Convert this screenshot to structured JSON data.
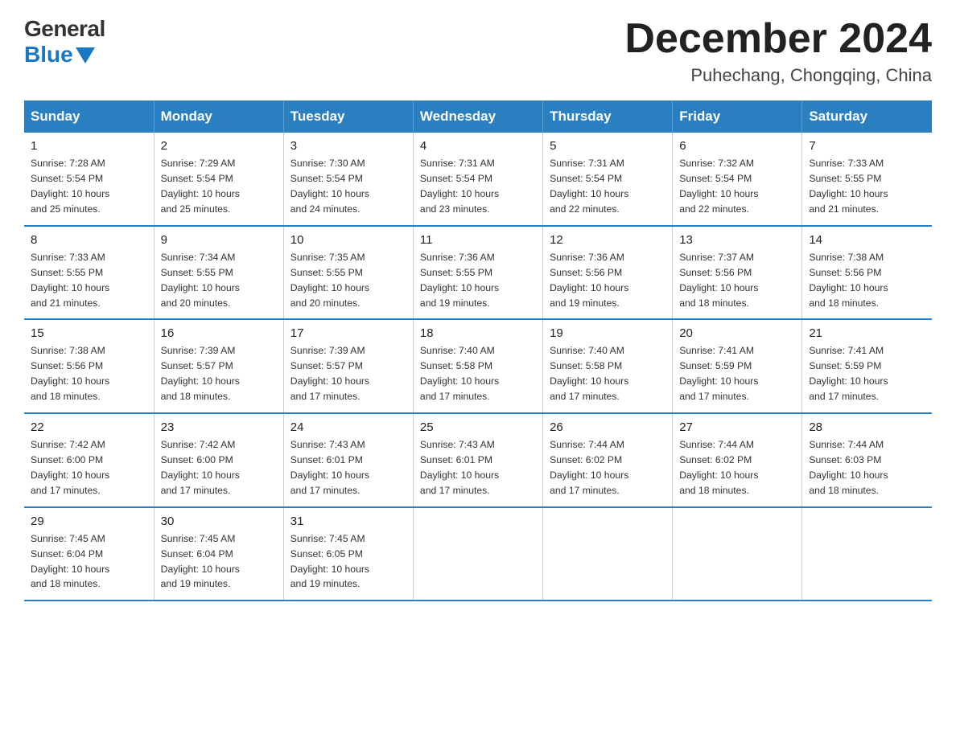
{
  "header": {
    "logo_general": "General",
    "logo_blue": "Blue",
    "title": "December 2024",
    "subtitle": "Puhechang, Chongqing, China"
  },
  "weekdays": [
    "Sunday",
    "Monday",
    "Tuesday",
    "Wednesday",
    "Thursday",
    "Friday",
    "Saturday"
  ],
  "weeks": [
    [
      {
        "day": "1",
        "info": "Sunrise: 7:28 AM\nSunset: 5:54 PM\nDaylight: 10 hours\nand 25 minutes."
      },
      {
        "day": "2",
        "info": "Sunrise: 7:29 AM\nSunset: 5:54 PM\nDaylight: 10 hours\nand 25 minutes."
      },
      {
        "day": "3",
        "info": "Sunrise: 7:30 AM\nSunset: 5:54 PM\nDaylight: 10 hours\nand 24 minutes."
      },
      {
        "day": "4",
        "info": "Sunrise: 7:31 AM\nSunset: 5:54 PM\nDaylight: 10 hours\nand 23 minutes."
      },
      {
        "day": "5",
        "info": "Sunrise: 7:31 AM\nSunset: 5:54 PM\nDaylight: 10 hours\nand 22 minutes."
      },
      {
        "day": "6",
        "info": "Sunrise: 7:32 AM\nSunset: 5:54 PM\nDaylight: 10 hours\nand 22 minutes."
      },
      {
        "day": "7",
        "info": "Sunrise: 7:33 AM\nSunset: 5:55 PM\nDaylight: 10 hours\nand 21 minutes."
      }
    ],
    [
      {
        "day": "8",
        "info": "Sunrise: 7:33 AM\nSunset: 5:55 PM\nDaylight: 10 hours\nand 21 minutes."
      },
      {
        "day": "9",
        "info": "Sunrise: 7:34 AM\nSunset: 5:55 PM\nDaylight: 10 hours\nand 20 minutes."
      },
      {
        "day": "10",
        "info": "Sunrise: 7:35 AM\nSunset: 5:55 PM\nDaylight: 10 hours\nand 20 minutes."
      },
      {
        "day": "11",
        "info": "Sunrise: 7:36 AM\nSunset: 5:55 PM\nDaylight: 10 hours\nand 19 minutes."
      },
      {
        "day": "12",
        "info": "Sunrise: 7:36 AM\nSunset: 5:56 PM\nDaylight: 10 hours\nand 19 minutes."
      },
      {
        "day": "13",
        "info": "Sunrise: 7:37 AM\nSunset: 5:56 PM\nDaylight: 10 hours\nand 18 minutes."
      },
      {
        "day": "14",
        "info": "Sunrise: 7:38 AM\nSunset: 5:56 PM\nDaylight: 10 hours\nand 18 minutes."
      }
    ],
    [
      {
        "day": "15",
        "info": "Sunrise: 7:38 AM\nSunset: 5:56 PM\nDaylight: 10 hours\nand 18 minutes."
      },
      {
        "day": "16",
        "info": "Sunrise: 7:39 AM\nSunset: 5:57 PM\nDaylight: 10 hours\nand 18 minutes."
      },
      {
        "day": "17",
        "info": "Sunrise: 7:39 AM\nSunset: 5:57 PM\nDaylight: 10 hours\nand 17 minutes."
      },
      {
        "day": "18",
        "info": "Sunrise: 7:40 AM\nSunset: 5:58 PM\nDaylight: 10 hours\nand 17 minutes."
      },
      {
        "day": "19",
        "info": "Sunrise: 7:40 AM\nSunset: 5:58 PM\nDaylight: 10 hours\nand 17 minutes."
      },
      {
        "day": "20",
        "info": "Sunrise: 7:41 AM\nSunset: 5:59 PM\nDaylight: 10 hours\nand 17 minutes."
      },
      {
        "day": "21",
        "info": "Sunrise: 7:41 AM\nSunset: 5:59 PM\nDaylight: 10 hours\nand 17 minutes."
      }
    ],
    [
      {
        "day": "22",
        "info": "Sunrise: 7:42 AM\nSunset: 6:00 PM\nDaylight: 10 hours\nand 17 minutes."
      },
      {
        "day": "23",
        "info": "Sunrise: 7:42 AM\nSunset: 6:00 PM\nDaylight: 10 hours\nand 17 minutes."
      },
      {
        "day": "24",
        "info": "Sunrise: 7:43 AM\nSunset: 6:01 PM\nDaylight: 10 hours\nand 17 minutes."
      },
      {
        "day": "25",
        "info": "Sunrise: 7:43 AM\nSunset: 6:01 PM\nDaylight: 10 hours\nand 17 minutes."
      },
      {
        "day": "26",
        "info": "Sunrise: 7:44 AM\nSunset: 6:02 PM\nDaylight: 10 hours\nand 17 minutes."
      },
      {
        "day": "27",
        "info": "Sunrise: 7:44 AM\nSunset: 6:02 PM\nDaylight: 10 hours\nand 18 minutes."
      },
      {
        "day": "28",
        "info": "Sunrise: 7:44 AM\nSunset: 6:03 PM\nDaylight: 10 hours\nand 18 minutes."
      }
    ],
    [
      {
        "day": "29",
        "info": "Sunrise: 7:45 AM\nSunset: 6:04 PM\nDaylight: 10 hours\nand 18 minutes."
      },
      {
        "day": "30",
        "info": "Sunrise: 7:45 AM\nSunset: 6:04 PM\nDaylight: 10 hours\nand 19 minutes."
      },
      {
        "day": "31",
        "info": "Sunrise: 7:45 AM\nSunset: 6:05 PM\nDaylight: 10 hours\nand 19 minutes."
      },
      {
        "day": "",
        "info": ""
      },
      {
        "day": "",
        "info": ""
      },
      {
        "day": "",
        "info": ""
      },
      {
        "day": "",
        "info": ""
      }
    ]
  ]
}
